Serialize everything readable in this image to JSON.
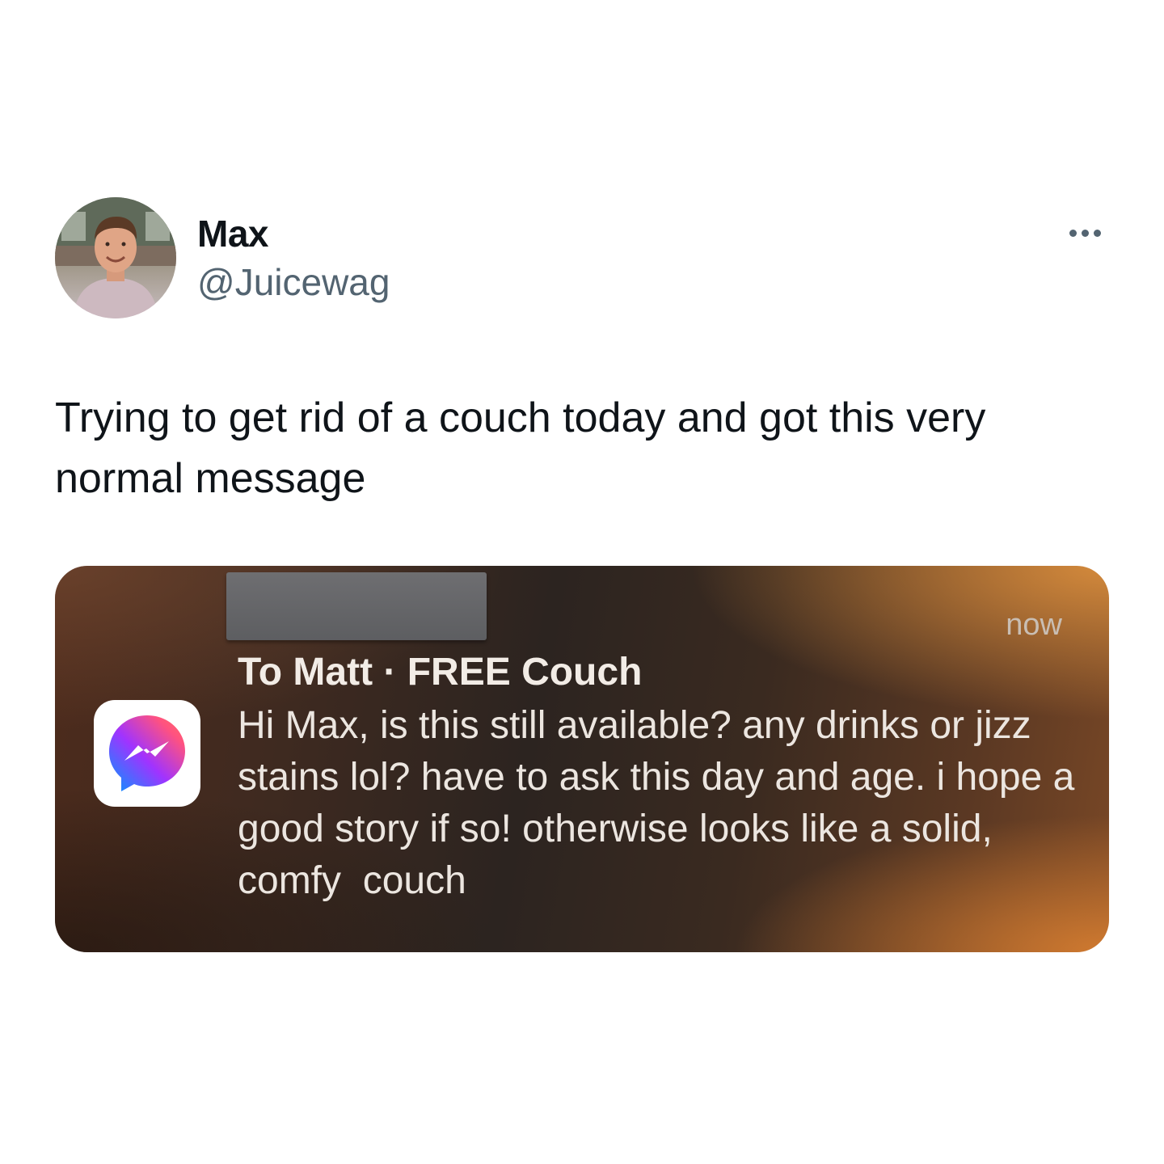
{
  "tweet": {
    "author": {
      "display_name": "Max",
      "handle": "@Juicewag",
      "avatar_icon": "profile-photo"
    },
    "more_icon": "more-horizontal-icon",
    "text": "Trying to get rid of a couch today and got this very normal message"
  },
  "attachment": {
    "notification": {
      "app_icon": "messenger-icon",
      "time": "now",
      "title": "To Matt · FREE Couch",
      "body": "Hi Max, is this still available? any drinks or jizz stains lol? have to ask this day and age. i hope a good story if so! otherwise looks like a solid, comfy  couch"
    }
  },
  "colors": {
    "text_primary": "#0f1419",
    "text_secondary": "#536471",
    "background": "#ffffff",
    "notification_bg": "#3a2a20",
    "messenger_gradient": [
      "#00b2ff",
      "#a334fa",
      "#ff5f6d"
    ]
  }
}
